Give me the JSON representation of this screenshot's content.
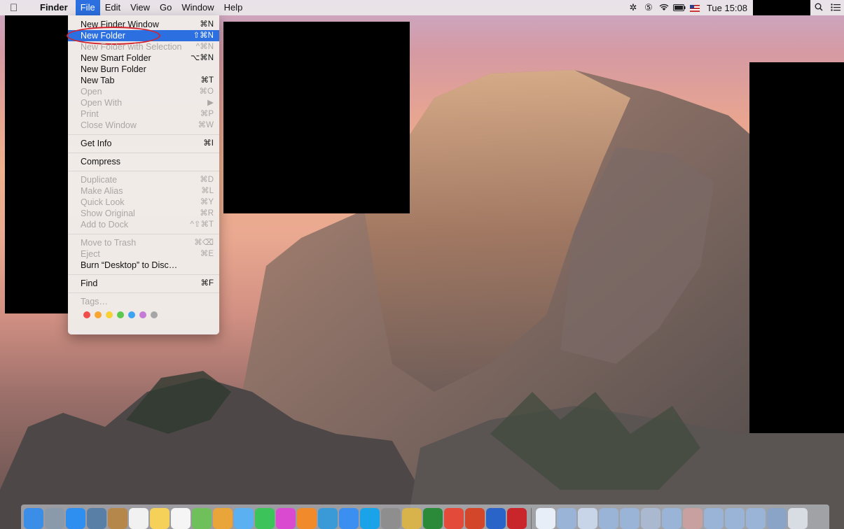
{
  "menubar": {
    "apple_icon": "apple-logo-icon",
    "app_name": "Finder",
    "menus": [
      "File",
      "Edit",
      "View",
      "Go",
      "Window",
      "Help"
    ],
    "active_menu": "File",
    "clock": "Tue 15:08",
    "status_icons": [
      "settings-gear-icon",
      "clipboard-icon",
      "wifi-icon",
      "battery-icon",
      "us-flag-icon"
    ]
  },
  "file_menu": {
    "items": [
      {
        "label": "New Finder Window",
        "shortcut": "⌘N",
        "enabled": true
      },
      {
        "label": "New Folder",
        "shortcut": "⇧⌘N",
        "enabled": true,
        "highlighted": true,
        "circled": true
      },
      {
        "label": "New Folder with Selection",
        "shortcut": "^⌘N",
        "enabled": false
      },
      {
        "label": "New Smart Folder",
        "shortcut": "⌥⌘N",
        "enabled": true
      },
      {
        "label": "New Burn Folder",
        "shortcut": "",
        "enabled": true
      },
      {
        "label": "New Tab",
        "shortcut": "⌘T",
        "enabled": true
      },
      {
        "label": "Open",
        "shortcut": "⌘O",
        "enabled": false
      },
      {
        "label": "Open With",
        "shortcut": "▶",
        "enabled": false
      },
      {
        "label": "Print",
        "shortcut": "⌘P",
        "enabled": false
      },
      {
        "label": "Close Window",
        "shortcut": "⌘W",
        "enabled": false
      },
      {
        "separator": true
      },
      {
        "label": "Get Info",
        "shortcut": "⌘I",
        "enabled": true
      },
      {
        "separator": true
      },
      {
        "label": "Compress",
        "shortcut": "",
        "enabled": true
      },
      {
        "separator": true
      },
      {
        "label": "Duplicate",
        "shortcut": "⌘D",
        "enabled": false
      },
      {
        "label": "Make Alias",
        "shortcut": "⌘L",
        "enabled": false
      },
      {
        "label": "Quick Look",
        "shortcut": "⌘Y",
        "enabled": false
      },
      {
        "label": "Show Original",
        "shortcut": "⌘R",
        "enabled": false
      },
      {
        "label": "Add to Dock",
        "shortcut": "^⇧⌘T",
        "enabled": false
      },
      {
        "separator": true
      },
      {
        "label": "Move to Trash",
        "shortcut": "⌘⌫",
        "enabled": false
      },
      {
        "label": "Eject",
        "shortcut": "⌘E",
        "enabled": false
      },
      {
        "label": "Burn “Desktop” to Disc…",
        "shortcut": "",
        "enabled": true
      },
      {
        "separator": true
      },
      {
        "label": "Find",
        "shortcut": "⌘F",
        "enabled": true
      },
      {
        "separator": true
      },
      {
        "label": "Tags…",
        "shortcut": "",
        "enabled": false
      }
    ],
    "tag_colors": [
      "#f14d4c",
      "#f8a531",
      "#f6d235",
      "#5bc94d",
      "#3fa3f3",
      "#c67ad8",
      "#a6a6a6"
    ]
  },
  "dock": {
    "apps": [
      {
        "name": "finder-icon",
        "color": "#3b8ee8"
      },
      {
        "name": "launchpad-icon",
        "color": "#8a9aab"
      },
      {
        "name": "safari-icon",
        "color": "#2f8ff0"
      },
      {
        "name": "preview-icon",
        "color": "#5a7fa6"
      },
      {
        "name": "contacts-icon",
        "color": "#b5874a"
      },
      {
        "name": "calendar-icon",
        "color": "#f1f1f1"
      },
      {
        "name": "notes-icon",
        "color": "#f5d15a"
      },
      {
        "name": "reminders-icon",
        "color": "#f5f5f5"
      },
      {
        "name": "maps-icon",
        "color": "#6fbf5a"
      },
      {
        "name": "photos-icon",
        "color": "#e9a43a"
      },
      {
        "name": "messages-icon",
        "color": "#5ab0f0"
      },
      {
        "name": "facetime-icon",
        "color": "#3cc35a"
      },
      {
        "name": "itunes-icon",
        "color": "#d94ad0"
      },
      {
        "name": "ibooks-icon",
        "color": "#f08a2a"
      },
      {
        "name": "xcode-icon",
        "color": "#3a9ad8"
      },
      {
        "name": "app-store-icon",
        "color": "#3a8ff0"
      },
      {
        "name": "skype-icon",
        "color": "#1aa3e8"
      },
      {
        "name": "system-preferences-icon",
        "color": "#8e8e8e"
      },
      {
        "name": "app-icon",
        "color": "#d8b24a"
      },
      {
        "name": "excel-icon",
        "color": "#2a8a3a"
      },
      {
        "name": "chrome-icon",
        "color": "#e44a3a"
      },
      {
        "name": "powerpoint-icon",
        "color": "#d4462a"
      },
      {
        "name": "word-icon",
        "color": "#2a64c8"
      },
      {
        "name": "filezilla-icon",
        "color": "#c8262a"
      }
    ],
    "docs": [
      {
        "name": "document-icon",
        "color": "#e8eef8"
      },
      {
        "name": "document-icon",
        "color": "#9ab4d8"
      },
      {
        "name": "document-icon",
        "color": "#c8d4e8"
      },
      {
        "name": "document-icon",
        "color": "#9ab4d8"
      },
      {
        "name": "document-icon",
        "color": "#9ab4d8"
      },
      {
        "name": "document-icon",
        "color": "#aab8d0"
      },
      {
        "name": "document-icon",
        "color": "#9ab4d8"
      },
      {
        "name": "document-icon",
        "color": "#c8a0a0"
      },
      {
        "name": "document-icon",
        "color": "#9ab4d8"
      },
      {
        "name": "document-icon",
        "color": "#9ab4d8"
      },
      {
        "name": "document-icon",
        "color": "#9ab4d8"
      },
      {
        "name": "document-icon",
        "color": "#8aa4c8"
      },
      {
        "name": "trash-icon",
        "color": "#d8dde4"
      }
    ]
  }
}
